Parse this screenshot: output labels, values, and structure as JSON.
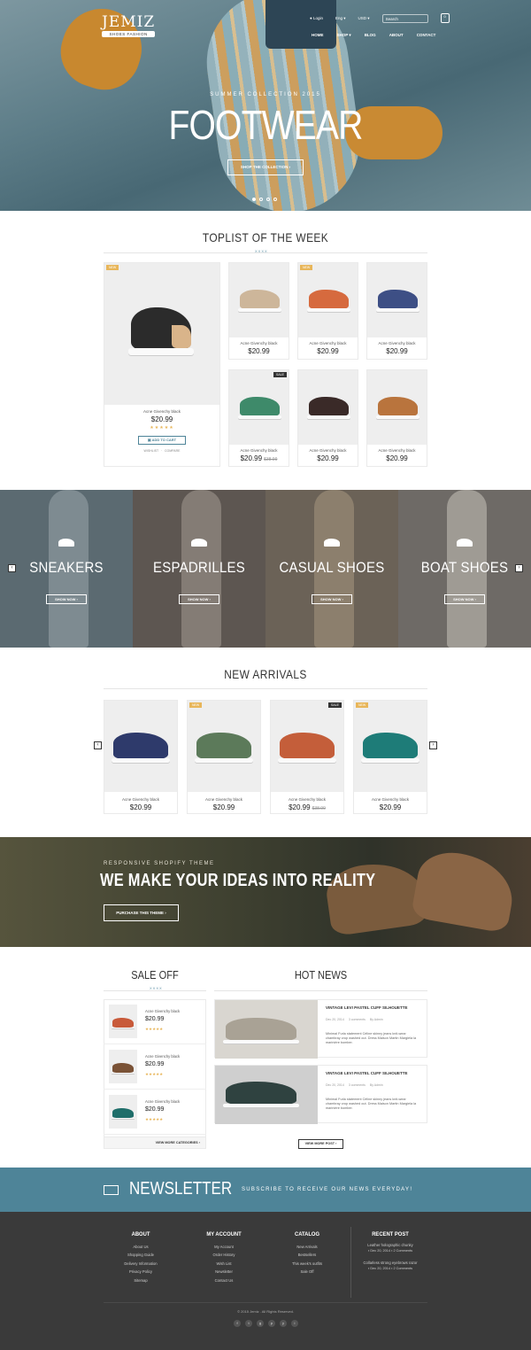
{
  "header": {
    "logo": "JEMIZ",
    "logo_tagline": "SHOES FASHION",
    "login": "Login",
    "language": "Eng",
    "currency": "USD",
    "search_placeholder": "Search",
    "cart_count": "0",
    "nav": [
      "HOME",
      "SHOP",
      "BLOG",
      "ABOUT",
      "CONTACT"
    ]
  },
  "hero": {
    "subtitle": "SUMMER COLLECTION 2015",
    "title": "FOOTWEAR",
    "button": "SHOP THE COLLECTION",
    "slides": 4,
    "active_slide": 1
  },
  "toplist": {
    "title": "TOPLIST OF THE WEEK",
    "deco": "XXXX",
    "featured": {
      "badge": "NEW",
      "name": "Acne Givenchy black",
      "price": "$20.99",
      "rating": 5,
      "add_to_cart": "ADD TO CART",
      "wishlist": "WISHLIST",
      "compare": "COMPARE"
    },
    "items": [
      {
        "name": "Acne Givenchy black",
        "price": "$20.99",
        "badge": "",
        "color": "#cdb69a"
      },
      {
        "name": "Acne Givenchy black",
        "price": "$20.99",
        "badge": "NEW",
        "color": "#d66a3e"
      },
      {
        "name": "Acne Givenchy black",
        "price": "$20.99",
        "badge": "",
        "color": "#3d4f85"
      },
      {
        "name": "Acne Givenchy black",
        "price": "$20.99",
        "old_price": "$38.99",
        "badge": "SALE",
        "color": "#3e8a6a"
      },
      {
        "name": "Acne Givenchy black",
        "price": "$20.99",
        "badge": "",
        "color": "#3a2a28"
      },
      {
        "name": "Acne Givenchy black",
        "price": "$20.99",
        "badge": "",
        "color": "#b9743d"
      }
    ]
  },
  "categories": {
    "items": [
      {
        "label": "SNEAKERS",
        "button": "SHOW NOW",
        "bg": "#5b6a71"
      },
      {
        "label": "ESPADRILLES",
        "button": "SHOW NOW",
        "bg": "#5d5651"
      },
      {
        "label": "CASUAL SHOES",
        "button": "SHOW NOW",
        "bg": "#6b6257"
      },
      {
        "label": "BOAT SHOES",
        "button": "SHOW NOW",
        "bg": "#6e6a66"
      }
    ]
  },
  "new_arrivals": {
    "title": "NEW ARRIVALS",
    "items": [
      {
        "name": "Acne Givenchy black",
        "price": "$20.99",
        "badge": "",
        "color": "#2e3a6b"
      },
      {
        "name": "Acne Givenchy black",
        "price": "$20.99",
        "badge": "NEW",
        "color": "#5c7a5a"
      },
      {
        "name": "Acne Givenchy black",
        "price": "$20.99",
        "old_price": "$38.99",
        "badge": "SALE",
        "color": "#c45e3a"
      },
      {
        "name": "Acne Givenchy black",
        "price": "$20.99",
        "badge": "NEW",
        "color": "#1e7c78"
      }
    ]
  },
  "banner": {
    "subtitle": "RESPONSIVE SHOPIFY THEME",
    "title": "WE MAKE YOUR IDEAS INTO REALITY",
    "button": "PURCHASE THIS THEME"
  },
  "sale_off": {
    "title": "SALE OFF",
    "deco": "XXXX",
    "items": [
      {
        "name": "Acne Givenchy black",
        "price": "$20.99",
        "color": "#c85a3a"
      },
      {
        "name": "Acne Givenchy black",
        "price": "$20.99",
        "color": "#7a5236"
      },
      {
        "name": "Acne Givenchy black",
        "price": "$20.99",
        "color": "#1f6e6a"
      }
    ],
    "more": "VIEW MORE CATEGORIES"
  },
  "hot_news": {
    "title": "HOT NEWS",
    "posts": [
      {
        "title": "VINTAGE LEVI PASTEL CUFF SILHOUETTE",
        "date": "Dec 20, 2014",
        "comments": "3 comments",
        "author": "By Admin",
        "excerpt": "Minimal Furla statement Céline skinny jeans knit-wear chambray crop washed out. Dress Maison Martin Margiela la marinière bomber."
      },
      {
        "title": "VINTAGE LEVI PASTEL CUFF SILHOUETTE",
        "date": "Dec 20, 2014",
        "comments": "3 comments",
        "author": "By Admin",
        "excerpt": "Minimal Furla statement Céline skinny jeans knit-wear chambray crop washed out. Dress Maison Martin Margiela la marinière bomber."
      }
    ],
    "more": "VIEW MORE POST"
  },
  "newsletter": {
    "title": "NEWSLETTER",
    "text": "SUBSCRIBE TO RECEIVE OUR NEWS EVERYDAY!"
  },
  "footer": {
    "about": {
      "title": "ABOUT",
      "links": [
        "About Us",
        "Shopping Guide",
        "Delivery Information",
        "Privacy Policy",
        "Sitemap"
      ]
    },
    "account": {
      "title": "MY ACCOUNT",
      "links": [
        "My Account",
        "Order History",
        "Wish List",
        "Newsletter",
        "Contact Us"
      ]
    },
    "catalog": {
      "title": "CATALOG",
      "links": [
        "New Arrivals",
        "Bestsellers",
        "This week's outfits",
        "Sale Off"
      ]
    },
    "recent": {
      "title": "RECENT POST",
      "posts": [
        {
          "title": "Leather holographic chunky",
          "date": "Dec 20, 2014",
          "comments": "2 Comments"
        },
        {
          "title": "Collarless strong eyebrows razor",
          "date": "Dec 20, 2014",
          "comments": "2 Comments"
        }
      ]
    },
    "copyright": "© 2015 Jemiz . All Rights Reserved.",
    "social": [
      "f",
      "t",
      "g",
      "p",
      "y",
      "i"
    ]
  }
}
